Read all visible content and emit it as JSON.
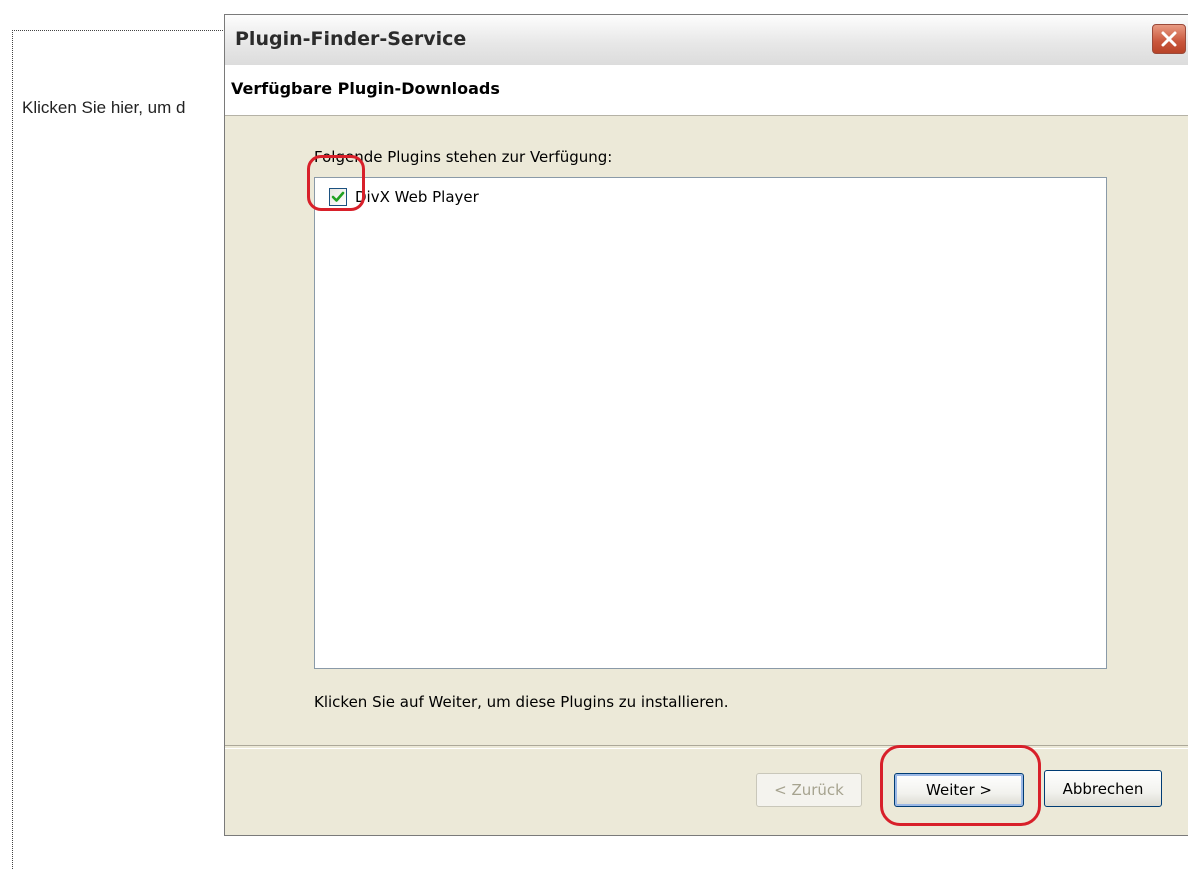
{
  "background_page": {
    "plugin_prompt_text": "Klicken Sie hier, um d"
  },
  "dialog": {
    "title": "Plugin-Finder-Service",
    "close_icon": "close-icon",
    "header_title": "Verfügbare Plugin-Downloads",
    "plugins_label": "Folgende Plugins stehen zur Verfügung:",
    "plugins": [
      {
        "name": "DivX Web Player",
        "checked": true
      }
    ],
    "hint_text": "Klicken Sie auf Weiter, um diese Plugins zu installieren.",
    "buttons": {
      "back": {
        "label": "< Zurück",
        "enabled": false
      },
      "next": {
        "label": "Weiter >",
        "enabled": true,
        "default": true
      },
      "cancel": {
        "label": "Abbrechen",
        "enabled": true
      }
    }
  },
  "annotations": {
    "highlight_color": "#d8202a",
    "highlighted": [
      "plugin-checkbox",
      "next-button"
    ]
  },
  "colors": {
    "dialog_background": "#ece9d8",
    "close_button": "#c9563c",
    "checkbox_check": "#21a121"
  }
}
